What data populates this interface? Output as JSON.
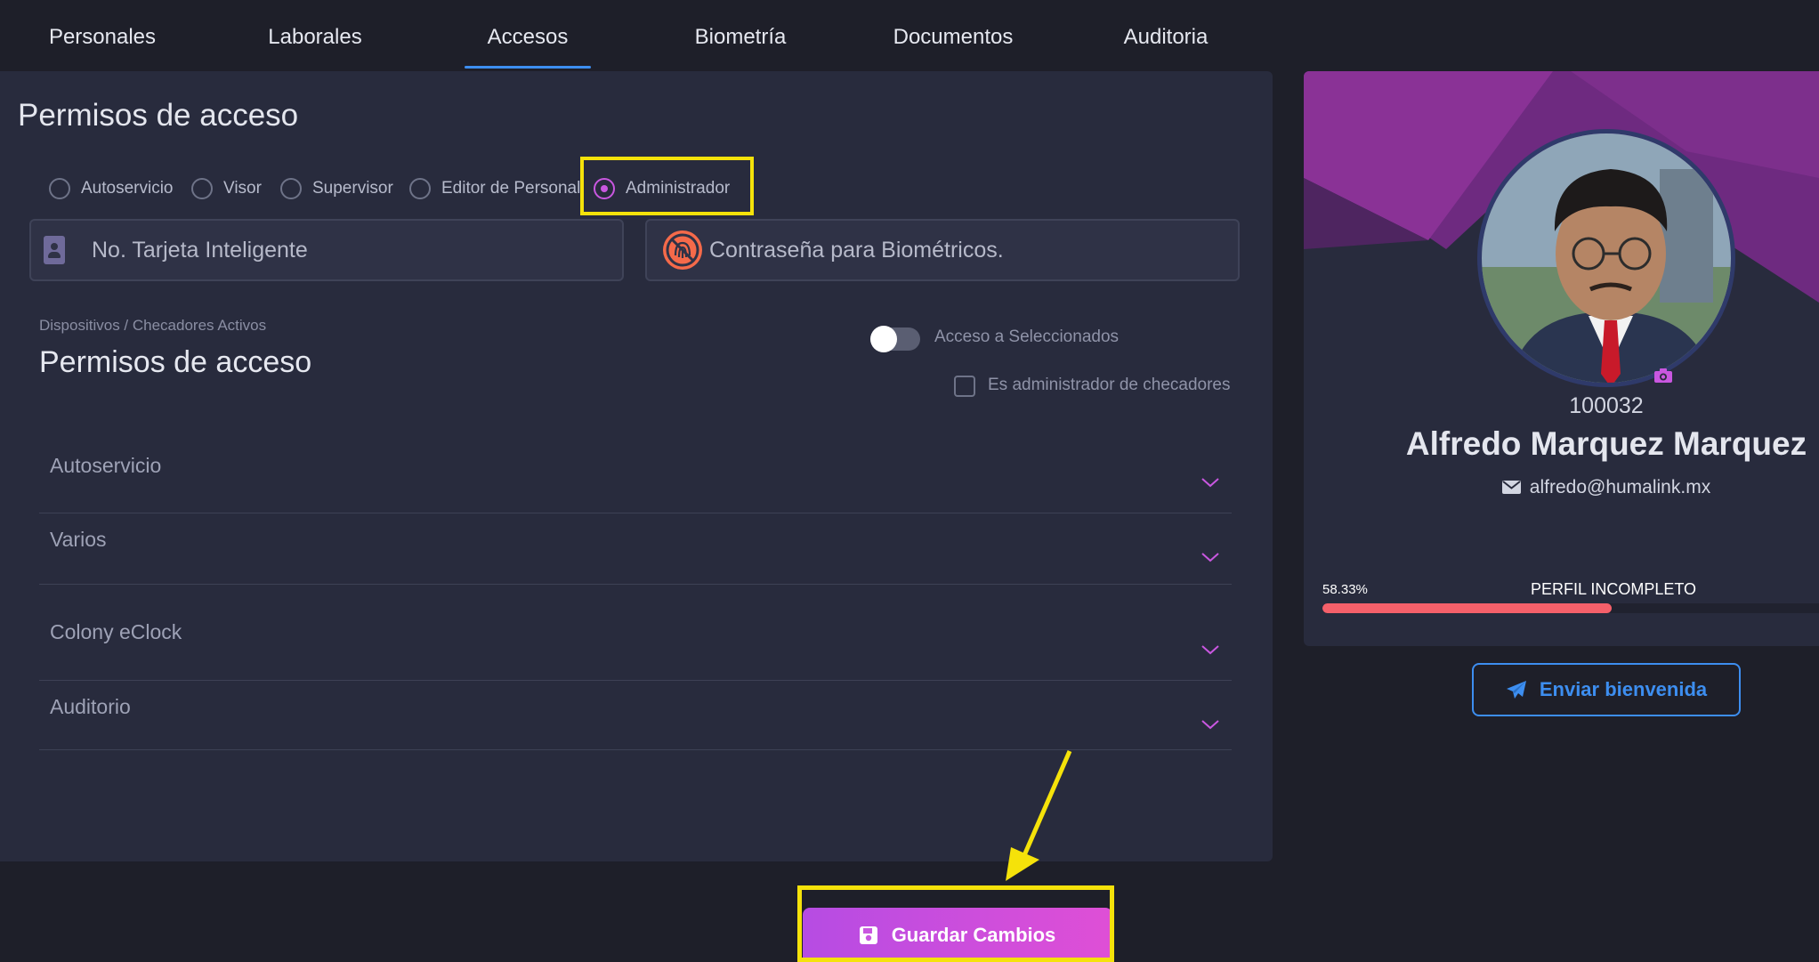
{
  "tabs": [
    {
      "label": "Personales"
    },
    {
      "label": "Laborales"
    },
    {
      "label": "Accesos",
      "active": true
    },
    {
      "label": "Biometría"
    },
    {
      "label": "Documentos"
    },
    {
      "label": "Auditoria"
    }
  ],
  "access": {
    "title": "Permisos de acceso",
    "roles": [
      {
        "label": "Autoservicio",
        "selected": false
      },
      {
        "label": "Visor",
        "selected": false
      },
      {
        "label": "Supervisor",
        "selected": false
      },
      {
        "label": "Editor de Personal",
        "selected": false
      },
      {
        "label": "Administrador",
        "selected": true
      }
    ],
    "smart_card_placeholder": "No. Tarjeta Inteligente",
    "biometric_password_placeholder": "Contraseña para Biométricos.",
    "devices_breadcrumb": "Dispositivos / Checadores Activos",
    "devices_title": "Permisos de acceso",
    "toggle_label": "Acceso a Seleccionados",
    "toggle_on": false,
    "checkbox_label": "Es administrador de checadores",
    "checkbox_checked": false,
    "sections": [
      {
        "label": "Autoservicio"
      },
      {
        "label": "Varios"
      },
      {
        "label": "Colony eClock"
      },
      {
        "label": "Auditorio"
      }
    ]
  },
  "profile": {
    "employee_number": "100032",
    "name": "Alfredo Marquez Marquez",
    "email": "alfredo@humalink.mx",
    "progress_text": "58.33%",
    "progress_value": 0.5833,
    "status": "PERFIL INCOMPLETO",
    "welcome_button": "Enviar bienvenida"
  },
  "save_button": "Guardar Cambios",
  "colors": {
    "accent_purple": "#c957e0",
    "accent_blue": "#3d8ef0",
    "highlight_yellow": "#f5e20a",
    "progress_red": "#f5606a"
  }
}
